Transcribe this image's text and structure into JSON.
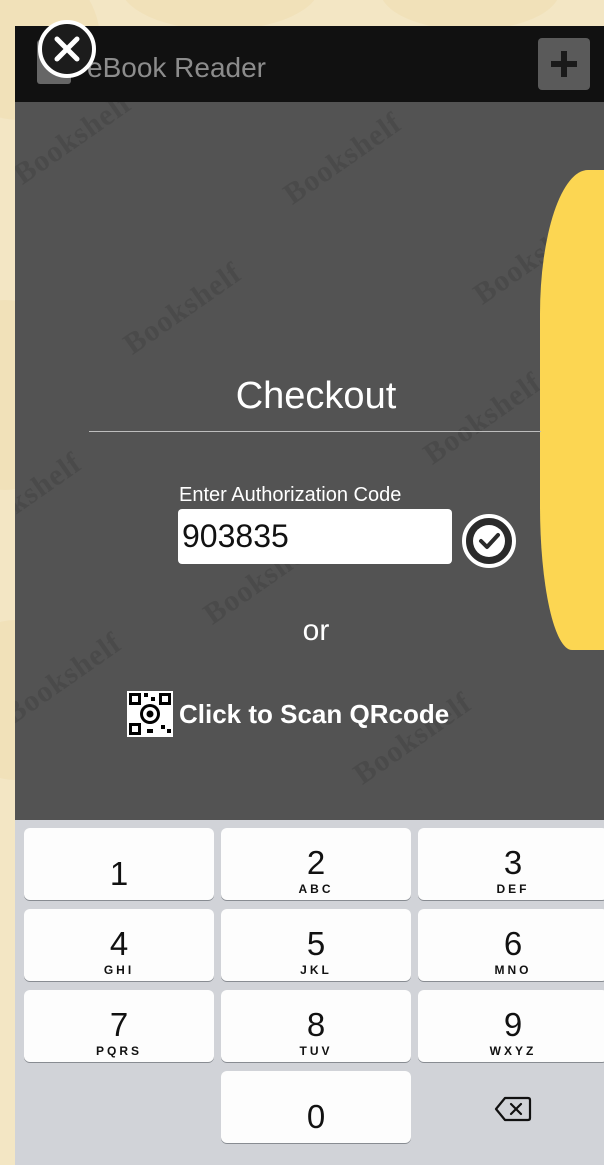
{
  "app": {
    "title": "eBook Reader",
    "add_icon": "plus-icon"
  },
  "watermark_text": "Bookshelf",
  "modal": {
    "close_icon": "close-circle-icon",
    "title": "Checkout",
    "code_label": "Enter Authorization Code",
    "code_value": "903835",
    "submit_icon": "checkmark-circle-icon",
    "or_text": "or",
    "scan_label": "Click to Scan QRcode",
    "scan_icon": "qrcode-icon"
  },
  "keypad": {
    "keys": [
      {
        "digit": "1",
        "letters": ""
      },
      {
        "digit": "2",
        "letters": "ABC"
      },
      {
        "digit": "3",
        "letters": "DEF"
      },
      {
        "digit": "4",
        "letters": "GHI"
      },
      {
        "digit": "5",
        "letters": "JKL"
      },
      {
        "digit": "6",
        "letters": "MNO"
      },
      {
        "digit": "7",
        "letters": "PQRS"
      },
      {
        "digit": "8",
        "letters": "TUV"
      },
      {
        "digit": "9",
        "letters": "WXYZ"
      },
      {
        "digit": "0",
        "letters": ""
      }
    ],
    "delete_icon": "backspace-icon"
  },
  "colors": {
    "accent_yellow": "#fcd652",
    "overlay": "#535353",
    "page_background": "#f3e6c4"
  }
}
